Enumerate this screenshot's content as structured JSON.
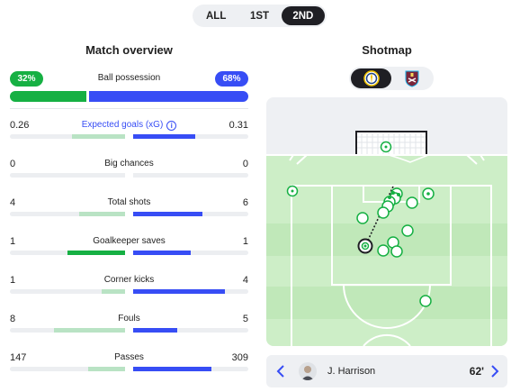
{
  "period_tabs": [
    "ALL",
    "1ST",
    "2ND"
  ],
  "overview": {
    "title": "Match overview",
    "possession": {
      "label": "Ball possession",
      "home": "32%",
      "away": "68%",
      "home_value": 32,
      "away_value": 68
    },
    "stats": [
      {
        "label": "Expected goals (xG)",
        "home": "0.26",
        "away": "0.31",
        "home_fill": 0.46,
        "away_fill": 0.54,
        "leader": "away",
        "has_info": true
      },
      {
        "label": "Big chances",
        "home": "0",
        "away": "0",
        "home_fill": 0,
        "away_fill": 0,
        "leader": "none",
        "has_info": false
      },
      {
        "label": "Total shots",
        "home": "4",
        "away": "6",
        "home_fill": 0.4,
        "away_fill": 0.6,
        "leader": "away",
        "has_info": false
      },
      {
        "label": "Goalkeeper saves",
        "home": "1",
        "away": "1",
        "home_fill": 0.5,
        "away_fill": 0.5,
        "leader": "both",
        "has_info": false
      },
      {
        "label": "Corner kicks",
        "home": "1",
        "away": "4",
        "home_fill": 0.2,
        "away_fill": 0.8,
        "leader": "away",
        "has_info": false
      },
      {
        "label": "Fouls",
        "home": "8",
        "away": "5",
        "home_fill": 0.62,
        "away_fill": 0.38,
        "leader": "away",
        "has_info": false
      },
      {
        "label": "Passes",
        "home": "147",
        "away": "309",
        "home_fill": 0.32,
        "away_fill": 0.68,
        "leader": "away",
        "has_info": false
      }
    ]
  },
  "shotmap": {
    "title": "Shotmap",
    "teams": [
      "leeds-united-crest",
      "west-ham-united-crest"
    ],
    "active_team": 0,
    "selected_shot": {
      "player": "J. Harrison",
      "minute": "62'"
    }
  },
  "colors": {
    "home": "#16b043",
    "away": "#374df5",
    "dark": "#1f1f24",
    "pitch": "#cdeec7",
    "pitch_stripe": "#c0e8b9"
  }
}
